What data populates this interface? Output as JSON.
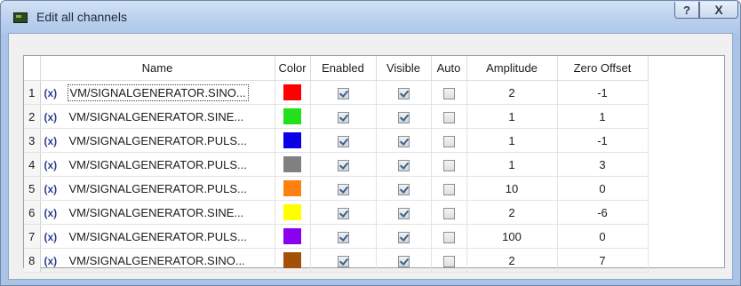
{
  "window": {
    "title": "Edit all channels",
    "help_label": "?",
    "close_label": "X"
  },
  "table": {
    "headers": [
      "",
      "Name",
      "Color",
      "Enabled",
      "Visible",
      "Auto",
      "Amplitude",
      "Zero Offset"
    ],
    "rows": [
      {
        "num": "1",
        "prefix": "(x)",
        "name": "VM/SIGNALGENERATOR.SINO...",
        "color": "#ff0000",
        "enabled": true,
        "visible": true,
        "auto": false,
        "amplitude": "2",
        "offset": "-1"
      },
      {
        "num": "2",
        "prefix": "(x)",
        "name": "VM/SIGNALGENERATOR.SINE...",
        "color": "#22e01c",
        "enabled": true,
        "visible": true,
        "auto": false,
        "amplitude": "1",
        "offset": "1"
      },
      {
        "num": "3",
        "prefix": "(x)",
        "name": "VM/SIGNALGENERATOR.PULS...",
        "color": "#0a00e6",
        "enabled": true,
        "visible": true,
        "auto": false,
        "amplitude": "1",
        "offset": "-1"
      },
      {
        "num": "4",
        "prefix": "(x)",
        "name": "VM/SIGNALGENERATOR.PULS...",
        "color": "#808080",
        "enabled": true,
        "visible": true,
        "auto": false,
        "amplitude": "1",
        "offset": "3"
      },
      {
        "num": "5",
        "prefix": "(x)",
        "name": "VM/SIGNALGENERATOR.PULS...",
        "color": "#ff7f10",
        "enabled": true,
        "visible": true,
        "auto": false,
        "amplitude": "10",
        "offset": "0"
      },
      {
        "num": "6",
        "prefix": "(x)",
        "name": "VM/SIGNALGENERATOR.SINE...",
        "color": "#ffff00",
        "enabled": true,
        "visible": true,
        "auto": false,
        "amplitude": "2",
        "offset": "-6"
      },
      {
        "num": "7",
        "prefix": "(x)",
        "name": "VM/SIGNALGENERATOR.PULS...",
        "color": "#8c00f0",
        "enabled": true,
        "visible": true,
        "auto": false,
        "amplitude": "100",
        "offset": "0"
      },
      {
        "num": "8",
        "prefix": "(x)",
        "name": "VM/SIGNALGENERATOR.SINO...",
        "color": "#a55008",
        "enabled": true,
        "visible": true,
        "auto": false,
        "amplitude": "2",
        "offset": "7"
      }
    ]
  }
}
